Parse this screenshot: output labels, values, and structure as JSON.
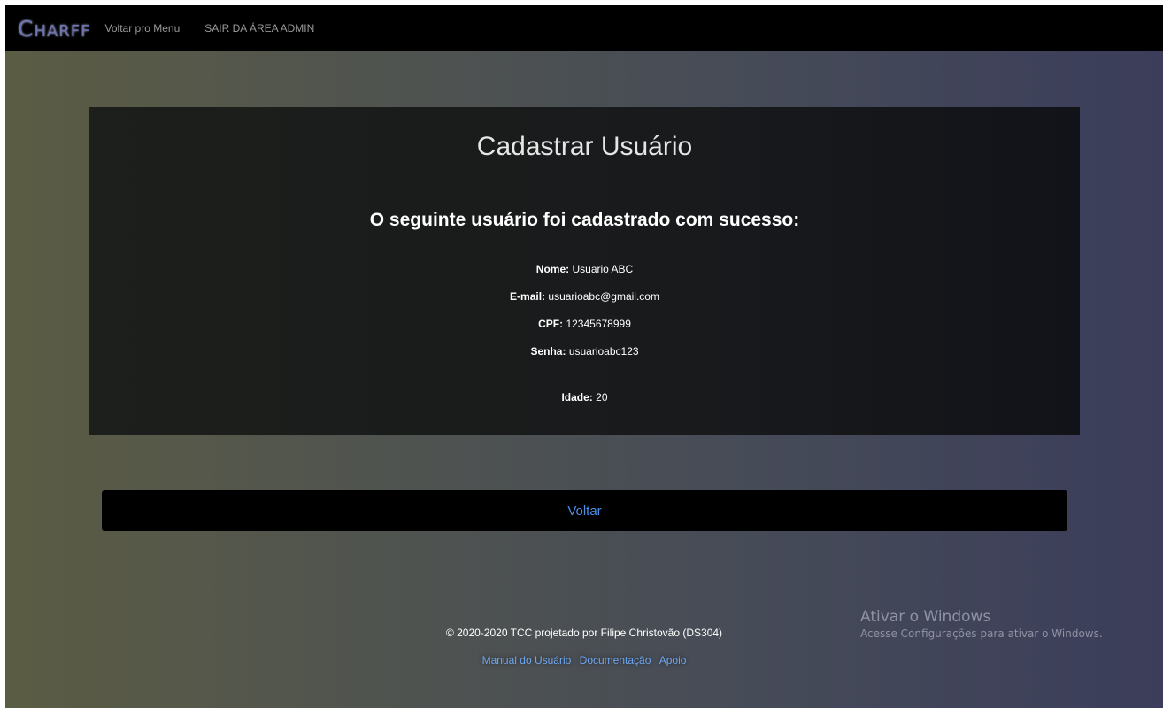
{
  "navbar": {
    "brand": "Charff",
    "links": [
      {
        "label": "Voltar pro Menu"
      },
      {
        "label": "SAIR DA ÁREA ADMIN"
      }
    ]
  },
  "card": {
    "title": "Cadastrar Usuário",
    "subtitle": "O seguinte usuário foi cadastrado com sucesso:",
    "fields": [
      {
        "label": "Nome:",
        "value": "Usuario ABC"
      },
      {
        "label": "E-mail:",
        "value": "usuarioabc@gmail.com"
      },
      {
        "label": "CPF:",
        "value": "12345678999"
      },
      {
        "label": "Senha:",
        "value": "usuarioabc123"
      },
      {
        "label": "Idade:",
        "value": "20"
      }
    ]
  },
  "back_button": {
    "label": "Voltar"
  },
  "footer": {
    "copyright": "© 2020-2020 TCC projetado por Filipe Christovão (DS304)",
    "links": [
      {
        "label": "Manual do Usuário"
      },
      {
        "label": "Documentação"
      },
      {
        "label": "Apoio"
      }
    ]
  },
  "windows_watermark": {
    "title": "Ativar o Windows",
    "subtitle": "Acesse Configurações para ativar o Windows."
  },
  "colors": {
    "brand": "#6e74ad",
    "link": "#4c8ee8",
    "footer_link": "#6ea6f2"
  }
}
